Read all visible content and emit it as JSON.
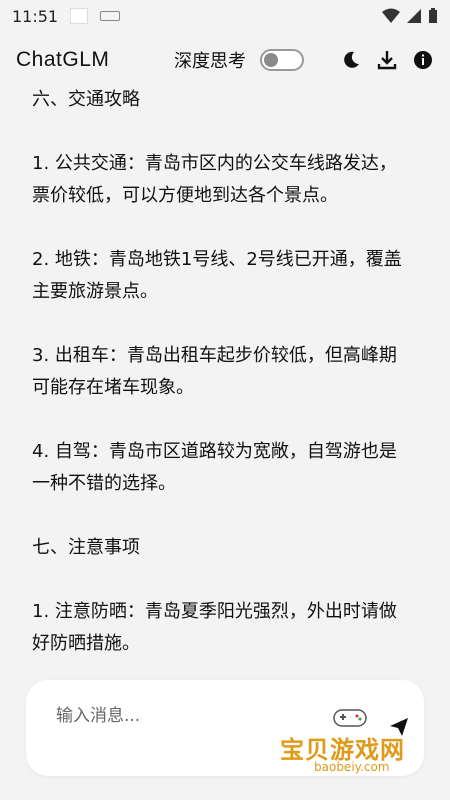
{
  "status": {
    "time": "11:51"
  },
  "appbar": {
    "title": "ChatGLM",
    "deep_think_label": "深度思考",
    "icons": [
      "moon-icon",
      "download-icon",
      "info-icon"
    ]
  },
  "content": {
    "paragraphs": [
      "六、交通攻略",
      "1. 公共交通：青岛市区内的公交车线路发达，票价较低，可以方便地到达各个景点。",
      "2. 地铁：青岛地铁1号线、2号线已开通，覆盖主要旅游景点。",
      "3. 出租车：青岛出租车起步价较低，但高峰期可能存在堵车现象。",
      "4. 自驾：青岛市区道路较为宽敞，自驾游也是一种不错的选择。",
      "七、注意事项",
      "1. 注意防晒：青岛夏季阳光强烈，外出时请做好防晒措施。"
    ]
  },
  "composer": {
    "placeholder": "输入消息..."
  },
  "watermark": {
    "text": "宝贝游戏网",
    "url": "baobeiy.com"
  }
}
